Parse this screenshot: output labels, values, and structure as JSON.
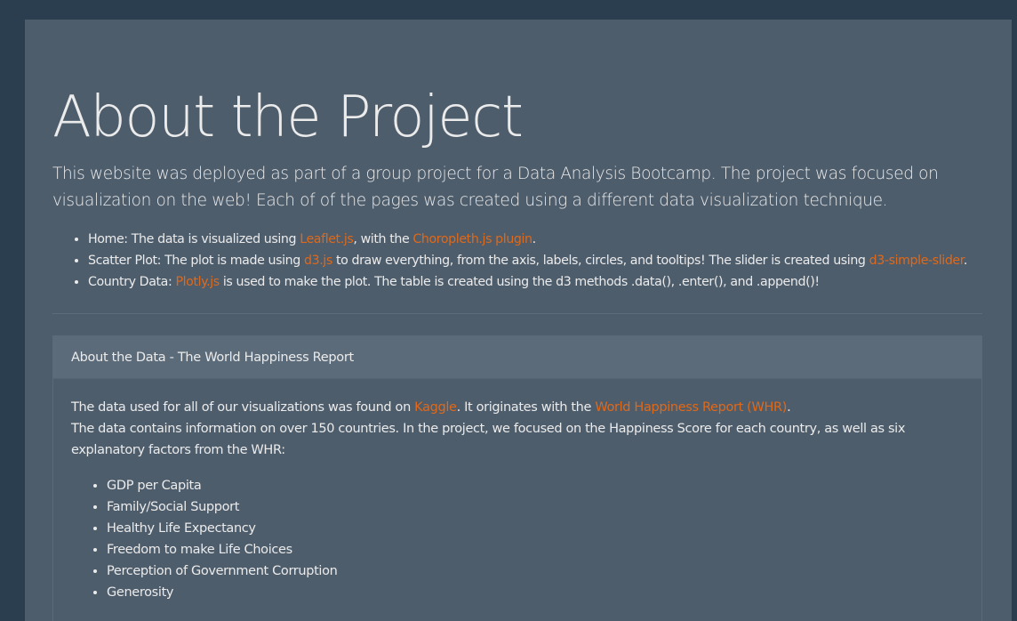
{
  "jumbotron": {
    "title": "About the Project",
    "lead": "This website was deployed as part of a group project for a Data Analysis Bootcamp. The project was focused on visualization on the web! Each of of the pages was created using a different data visualization technique.",
    "items": [
      {
        "prefix": "Home: The data is visualized using ",
        "link1": "Leaflet.js",
        "mid": ", with the ",
        "link2": "Choropleth.js plugin",
        "suffix": "."
      },
      {
        "prefix": "Scatter Plot: The plot is made using ",
        "link1": "d3.js",
        "mid": " to draw everything, from the axis, labels, circles, and tooltips! The slider is created using ",
        "link2": "d3-simple-slider",
        "suffix": "."
      },
      {
        "prefix": "Country Data: ",
        "link1": "Plotly.js",
        "suffix": " is used to make the plot. The table is created using the d3 methods .data(), .enter(), and .append()!"
      }
    ]
  },
  "card": {
    "header": "About the Data - The World Happiness Report",
    "p1_prefix": "The data used for all of our visualizations was found on ",
    "p1_link1": "Kaggle",
    "p1_mid": ". It originates with the ",
    "p1_link2": "World Happiness Report (WHR)",
    "p1_suffix": ".",
    "p2": "The data contains information on over 150 countries. In the project, we focused on the Happiness Score for each country, as well as six explanatory factors from the WHR:",
    "factors": [
      "GDP per Capita",
      "Family/Social Support",
      "Healthy Life Expectancy",
      "Freedom to make Life Choices",
      "Perception of Government Corruption",
      "Generosity"
    ]
  },
  "colors": {
    "page_background": "#2b3e50",
    "jumbotron_background": "#4e5d6c",
    "card_header_background": "#5c6b7a",
    "text": "#ebebeb",
    "link": "#df691a"
  }
}
